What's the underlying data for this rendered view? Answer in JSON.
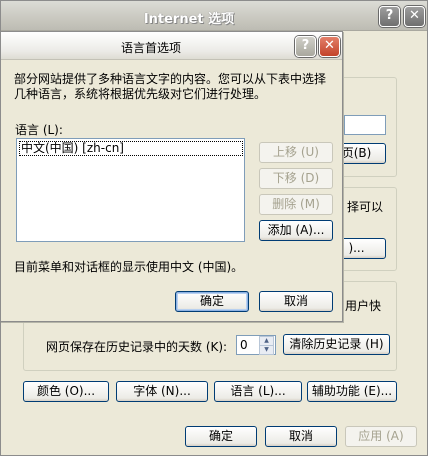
{
  "outer": {
    "title": "Internet 选项",
    "help_label": "?",
    "close_label": "✕",
    "visible_text": {
      "frag_page_btn": "页(B)",
      "frag_can": "择可以",
      "frag_btn2": ")...",
      "frag_userfast": "用户快"
    },
    "history": {
      "days_label": "网页保存在历史记录中的天数 (K):",
      "days_value": "0",
      "clear_button": "清除历史记录 (H)"
    },
    "bottom_buttons": {
      "colors": "颜色 (O)...",
      "fonts": "字体 (N)...",
      "languages": "语言 (L)...",
      "accessibility": "辅助功能 (E)..."
    },
    "dialog_buttons": {
      "ok": "确定",
      "cancel": "取消",
      "apply": "应用 (A)"
    }
  },
  "inner": {
    "title": "语言首选项",
    "help_label": "?",
    "close_label": "✕",
    "intro_line1": "部分网站提供了多种语言文字的内容。您可以从下表中选择",
    "intro_line2": "几种语言，系统将根据优先级对它们进行处理。",
    "language_label": "语言 (L):",
    "languages": [
      "中文(中国) [zh-cn]"
    ],
    "buttons": {
      "move_up": "上移 (U)",
      "move_down": "下移 (D)",
      "remove": "删除 (M)",
      "add": "添加 (A)..."
    },
    "menu_language_text": "目前菜单和对话框的显示使用中文 (中国)。",
    "ok": "确定",
    "cancel": "取消"
  }
}
